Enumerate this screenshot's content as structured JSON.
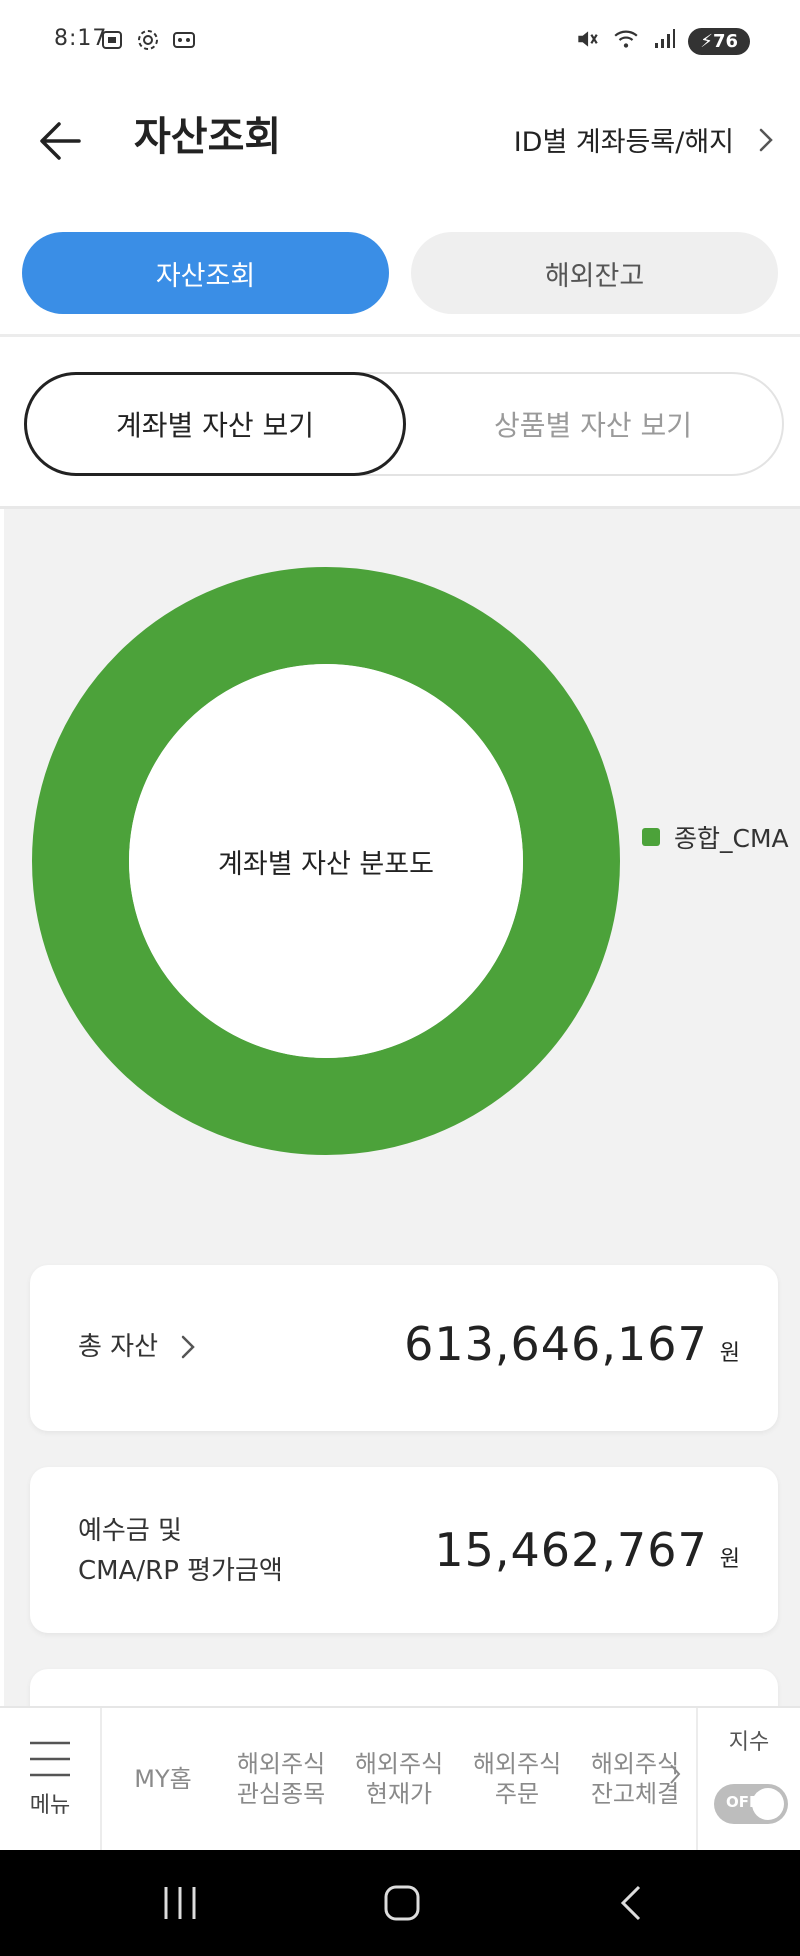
{
  "status_bar": {
    "time": "8:17",
    "battery": "76",
    "left_icons": [
      "screenshot-icon",
      "gear-icon",
      "voicemail-icon"
    ],
    "right_icons": [
      "mute-icon",
      "wifi-icon",
      "signal-icon",
      "battery-icon"
    ]
  },
  "header": {
    "title": "자산조회",
    "link_label": "ID별 계좌등록/해지"
  },
  "primary_tabs": [
    {
      "label": "자산조회",
      "active": true
    },
    {
      "label": "해외잔고",
      "active": false
    }
  ],
  "secondary_tabs": [
    {
      "label": "계좌별 자산 보기",
      "active": true
    },
    {
      "label": "상품별 자산 보기",
      "active": false
    }
  ],
  "chart_data": {
    "type": "pie",
    "variant": "donut",
    "center_label": "계좌별 자산 분포도",
    "categories": [
      "종합_CMA"
    ],
    "values": [
      100
    ],
    "colors": [
      "#4ca23a"
    ],
    "legend_position": "right"
  },
  "summary": {
    "total": {
      "label": "총 자산",
      "amount": "613,646,167",
      "unit": "원"
    },
    "deposit": {
      "label_line1": "예수금 및",
      "label_line2": "CMA/RP 평가금액",
      "amount": "15,462,767",
      "unit": "원"
    }
  },
  "bottom_nav": {
    "menu_label": "메뉴",
    "items": [
      {
        "line1": "MY홈",
        "line2": ""
      },
      {
        "line1": "해외주식",
        "line2": "관심종목"
      },
      {
        "line1": "해외주식",
        "line2": "현재가"
      },
      {
        "line1": "해외주식",
        "line2": "주문"
      },
      {
        "line1": "해외주식",
        "line2": "잔고체결"
      }
    ],
    "index_label": "지수",
    "toggle_label": "OFF"
  },
  "colors": {
    "accent": "#3a8ee6",
    "chart_green": "#4ca23a",
    "content_bg": "#f2f2f2"
  }
}
